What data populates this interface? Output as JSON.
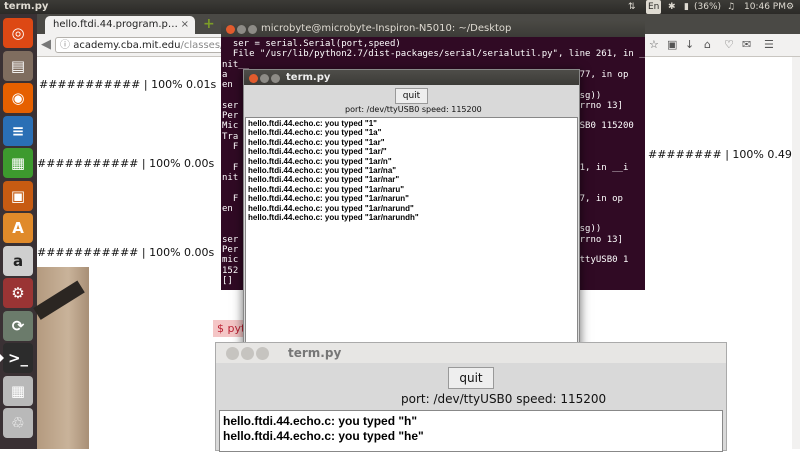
{
  "topbar": {
    "app_title": "term.py",
    "lang": "En",
    "battery": "(36%)",
    "time": "10:46 PM"
  },
  "launcher": {
    "items": [
      {
        "name": "dash-icon",
        "color": "#dd4814"
      },
      {
        "name": "files-icon",
        "color": "#7f6d5f"
      },
      {
        "name": "firefox-icon",
        "color": "#e66000"
      },
      {
        "name": "writer-icon",
        "color": "#2a6fb5"
      },
      {
        "name": "calc-icon",
        "color": "#3d9a2e"
      },
      {
        "name": "impress-icon",
        "color": "#c75b12"
      },
      {
        "name": "software-center-icon",
        "color": "#e08a2a"
      },
      {
        "name": "amazon-icon",
        "color": "#cfcfcf"
      },
      {
        "name": "system-settings-icon",
        "color": "#9a3434"
      },
      {
        "name": "updater-icon",
        "color": "#6b7b6b"
      },
      {
        "name": "terminal-icon",
        "color": "#2c2c2c"
      },
      {
        "name": "workspaces-icon",
        "color": "#b9b9b9"
      },
      {
        "name": "trash-icon",
        "color": "#b9b9b9"
      }
    ]
  },
  "browser": {
    "tab_label": "hello.ftdi.44.program.p…",
    "url_host": "academy.cba.mit.edu",
    "url_path": "/classes/embed",
    "progress_lines": [
      "########### | 100% 0.01s",
      "########### | 100% 0.00s",
      "########### | 100% 0.00s",
      "######## | 100% 0.49s"
    ],
    "prompt_fragment": "$ pyt"
  },
  "terminal": {
    "title": "microbyte@microbyte-Inspiron-N5010: ~/Desktop",
    "lines": [
      "  ser = serial.Serial(port,speed)",
      "  File \"/usr/lib/python2.7/dist-packages/serial/serialutil.py\", line 261, in __i",
      "nit__",
      "a                                                             ne 277, in op",
      "en",
      "                                                              t, msg))",
      "ser                                                           : [Errno 13]",
      "Per",
      "Mic                                                           ttyUSB0 115200",
      "Tra",
      "  F",
      "",
      "  F                                                           e 261, in __i",
      "nit",
      "",
      "  F                                                           e 277, in op",
      "en",
      "",
      "                                                              t, msg))",
      "ser                                                           : [Errno 13]",
      "Per",
      "mic                                                           dev/ttyUSB0 1",
      "152",
      "[]"
    ]
  },
  "term1": {
    "title": "term.py",
    "quit_label": "quit",
    "port_line": "port: /dev/ttyUSB0   speed: 115200",
    "lines": [
      "hello.ftdi.44.echo.c: you typed \"1\"",
      "hello.ftdi.44.echo.c: you typed \"1a\"",
      "hello.ftdi.44.echo.c: you typed \"1ar\"",
      "hello.ftdi.44.echo.c: you typed \"1ar/\"",
      "hello.ftdi.44.echo.c: you typed \"1ar/n\"",
      "hello.ftdi.44.echo.c: you typed \"1ar/na\"",
      "hello.ftdi.44.echo.c: you typed \"1ar/nar\"",
      "hello.ftdi.44.echo.c: you typed \"1ar/naru\"",
      "hello.ftdi.44.echo.c: you typed \"1ar/narun\"",
      "hello.ftdi.44.echo.c: you typed \"1ar/narund\"",
      "hello.ftdi.44.echo.c: you typed \"1ar/narundh\""
    ]
  },
  "term2": {
    "title": "term.py",
    "quit_label": "quit",
    "port_line": "port: /dev/ttyUSB0    speed: 115200",
    "lines": [
      "hello.ftdi.44.echo.c: you typed \"h\"",
      "hello.ftdi.44.echo.c: you typed \"he\""
    ]
  }
}
